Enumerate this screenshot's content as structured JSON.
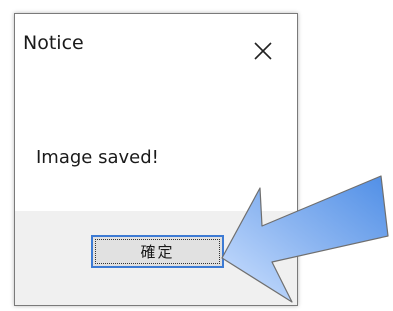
{
  "dialog": {
    "title": "Notice",
    "message": "Image saved!",
    "ok_label": "確定",
    "close_icon": "close-icon"
  },
  "annotation": {
    "arrow_color": "#4f8ee6",
    "arrow_outline": "#7a7a7a"
  }
}
